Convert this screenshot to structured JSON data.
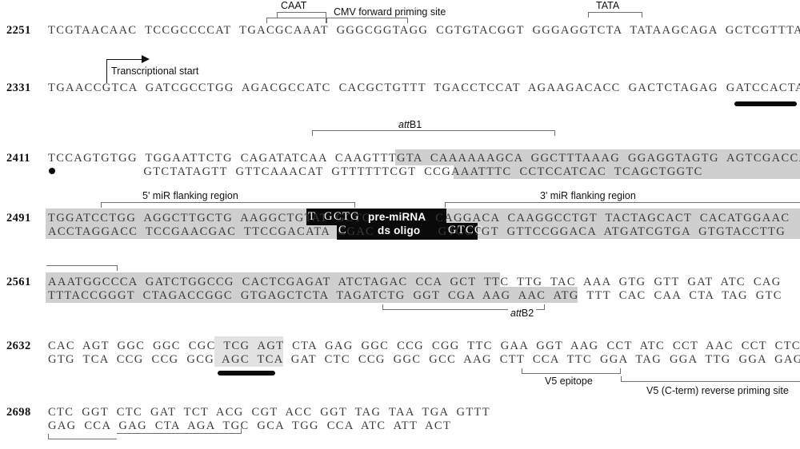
{
  "figure": {
    "kind": "plasmid-sequence-map",
    "description": "Annotated double-stranded DNA sequence map with feature brackets"
  },
  "lines": [
    {
      "coord": "2251",
      "top": "TCGTAACAAC  TCCGCCCCAT  TGACGCAAAT  GGGCGGTAGG  CGTGTACGGT  GGGAGGTCTA  TATAAGCAGA  GCTCGTTTAG",
      "bottom": ""
    },
    {
      "coord": "2331",
      "top": "TGAACCGTCA  GATCGCCTGG  AGACGCCATC  CACGCTGTTT  TGACCTCCAT  AGAAGACACC  GACTCTAGAG  GATCCACTAG",
      "bottom": ""
    },
    {
      "coord": "2411",
      "top": "TCCAGTGTGG  TGGAATTCTG  CAGATATCAA  CAAGTTTGTA  CAAAAAAGCA  GGCTTTAAAG  GGAGGTAGTG  AGTCGACCAG",
      "bottom": "                        GTCTATAGTT  GTTCAAACAT  GTTTTTTCGT  CCGAAATTTC  CCTCCATCAC  TCAGCTGGTC"
    },
    {
      "coord": "2491",
      "top": "TGGATCCTGG  AGGCTTGCTG  AAGGCTGTAT  GCTG                CAGGACA  CAAGGCCTGT  TACTAGCACT  CACATGGAAC",
      "bottom": "ACCTAGGACC  TCCGAACGAC  TTCCGACATA  CGAC                GTCCTGT  GTTCCGGACA  ATGATCGTGA  GTGTACCTTG"
    },
    {
      "coord": "2561",
      "top": "AAATGGCCCA  GATCTGGCCG  CACTCGAGAT  ATCTAGAC  CCA  GCT  TTC  TTG  TAC  AAA  GTG  GTT  GAT  ATC  CAG",
      "bottom": "TTTACCGGGT  CTAGACCGGC  GTGAGCTCTA  TAGATCTG  GGT  CGA  AAG  AAC  ATG  TTT  CAC  CAA  CTA  TAG  GTC"
    },
    {
      "coord": "2632",
      "top": "CAC  AGT  GGC  GGC  CGC  TCG  AGT  CTA  GAG  GGC  CCG  CGG  TTC  GAA  GGT  AAG  CCT  ATC  CCT  AAC  CCT  CTC",
      "bottom": "GTG  TCA  CCG  CCG  GCG  AGC  TCA  GAT  CTC  CCG  GGC  GCC  AAG  CTT  CCA  TTC  GGA  TAG  GGA  TTG  GGA  GAG"
    },
    {
      "coord": "2698",
      "top": "CTC  GGT  CTC  GAT  TCT  ACG  CGT  ACC  GGT  TAG  TAA  TGA  GTTT",
      "bottom": "GAG  CCA  GAG  CTA  AGA  TGC  GCA  TGG  CCA  ATC  ATT  ACT"
    }
  ],
  "features": [
    {
      "id": "caat",
      "label": "CAAT"
    },
    {
      "id": "cmv_fwd",
      "label": "CMV forward priming site"
    },
    {
      "id": "tata",
      "label": "TATA"
    },
    {
      "id": "tstart",
      "label": "Transcriptional start"
    },
    {
      "id": "attb1",
      "label_pre": "att",
      "label_post": "B1"
    },
    {
      "id": "mir5",
      "label": "5' miR flanking region"
    },
    {
      "id": "mir3",
      "label": "3' miR flanking region"
    },
    {
      "id": "attb2",
      "label_pre": "att",
      "label_post": "B2"
    },
    {
      "id": "v5_epitope",
      "label": "V5 epitope"
    },
    {
      "id": "v5_reverse",
      "label": "V5 (C-term) reverse priming site"
    }
  ],
  "oligo_box": {
    "line1": "pre-miRNA",
    "line2": "ds oligo",
    "top_flank": "T",
    "bot_flank": "C",
    "top_inner": "GCTG",
    "bot_inner": "GTCC"
  },
  "colors": {
    "shade": "#cfcfcf",
    "shade_light": "#e2e2e2",
    "black_box": "#0a0a0a",
    "bracket": "#6f6f76",
    "text": "#3a3a3a",
    "coord_text": "#111111"
  }
}
